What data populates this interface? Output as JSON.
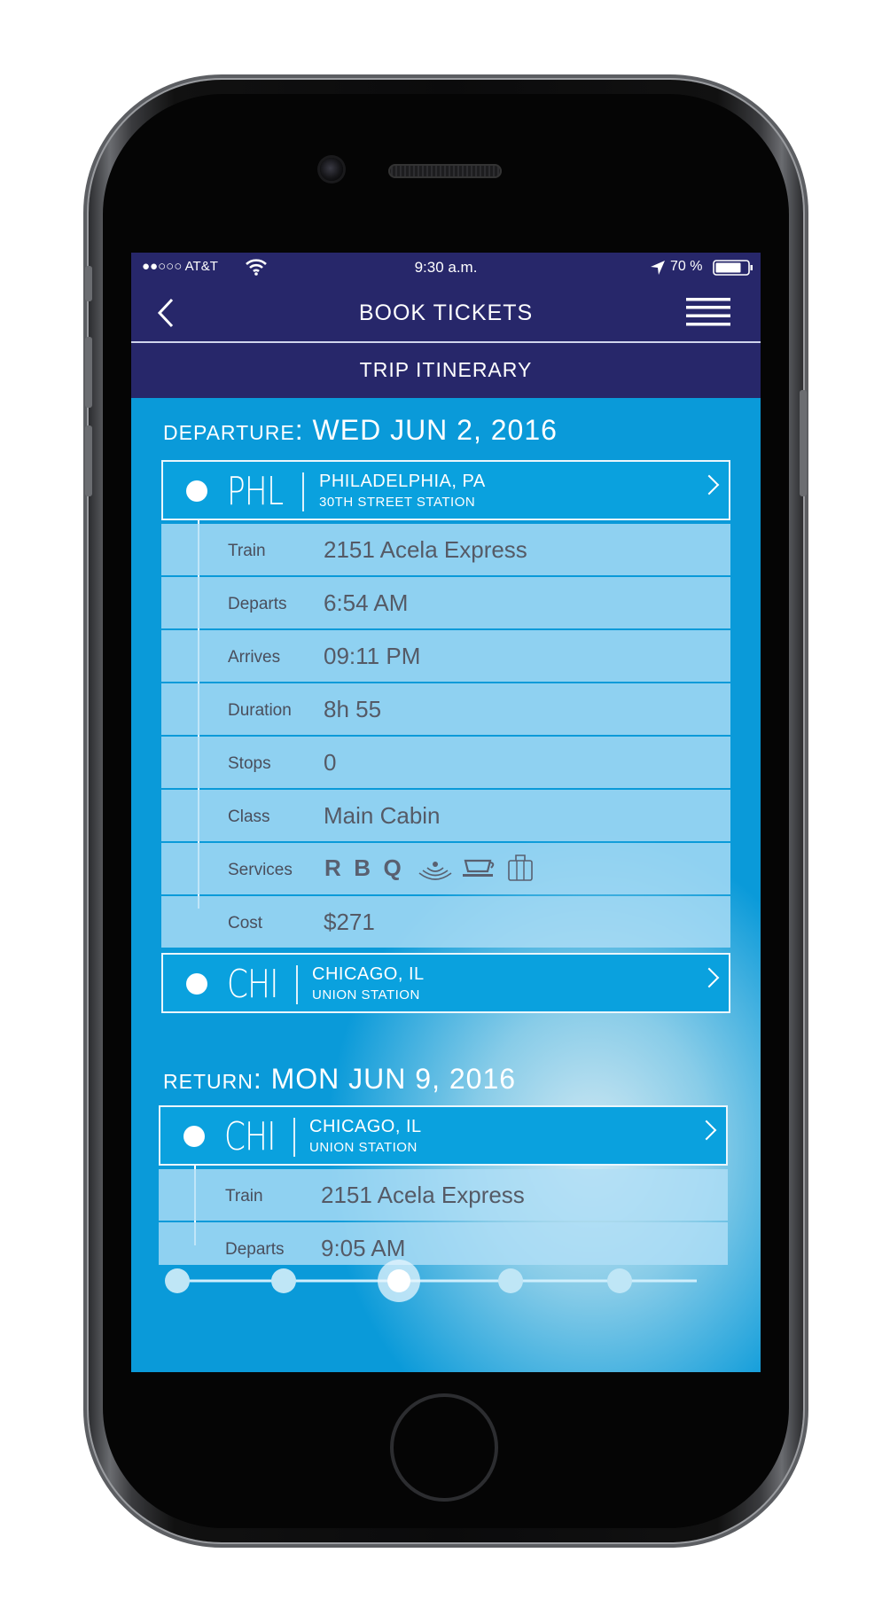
{
  "status": {
    "carrier": "●●○○○ AT&T",
    "time": "9:30 a.m.",
    "battery": "70 %"
  },
  "nav": {
    "title": "BOOK TICKETS",
    "subtitle": "TRIP ITINERARY"
  },
  "departure": {
    "label": "DEPARTURE",
    "colon": ":",
    "date": "WED JUN 2, 2016",
    "origin": {
      "code": "PHL",
      "city": "PHILADELPHIA, PA",
      "station": "30TH STREET STATION"
    },
    "destination": {
      "code": "CHI",
      "city": "CHICAGO, IL",
      "station": "UNION STATION"
    },
    "details": [
      {
        "label": "Train",
        "value": "2151 Acela Express"
      },
      {
        "label": "Departs",
        "value": "6:54 AM"
      },
      {
        "label": "Arrives",
        "value": "09:11 PM"
      },
      {
        "label": "Duration",
        "value": "8h 55"
      },
      {
        "label": "Stops",
        "value": "0"
      },
      {
        "label": "Class",
        "value": "Main Cabin"
      },
      {
        "label": "Services",
        "value": ""
      },
      {
        "label": "Cost",
        "value": "$271"
      }
    ],
    "services": [
      "R",
      "B",
      "Q"
    ]
  },
  "return": {
    "label": "RETURN",
    "colon": ":",
    "date": "MON JUN 9, 2016",
    "origin": {
      "code": "CHI",
      "city": "CHICAGO, IL",
      "station": "UNION STATION"
    },
    "details": [
      {
        "label": "Train",
        "value": "2151 Acela Express"
      },
      {
        "label": "Departs",
        "value": "9:05 AM"
      }
    ]
  },
  "pager": {
    "steps": 5,
    "active_step": 3
  },
  "colors": {
    "header": "#27276a",
    "screen_blue": "#0a9ad9",
    "row_fill": "#b0def6"
  }
}
